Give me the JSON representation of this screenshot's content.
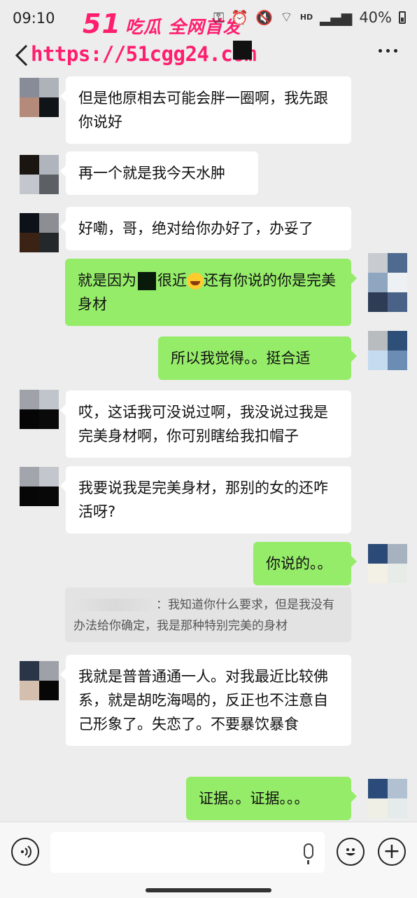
{
  "status": {
    "time": "09:10",
    "battery": "40%",
    "network": "HD"
  },
  "watermark": {
    "logo_number": "51",
    "logo_text": "吃瓜 全网首发",
    "url": "https://51cgg24.com"
  },
  "messages": [
    {
      "side": "left",
      "text": "但是他原相去可能会胖一圈啊，我先跟你说好"
    },
    {
      "side": "left",
      "text": "再一个就是我今天水肿"
    },
    {
      "side": "left",
      "text": "好嘞，哥，绝对给你办好了，办妥了"
    },
    {
      "side": "right",
      "text_a": "就是因为",
      "text_b": "很近",
      "text_c": "还有你说的你是完美身材"
    },
    {
      "side": "right",
      "text": "所以我觉得。。挺合适"
    },
    {
      "side": "left",
      "text": "哎，这话我可没说过啊，我没说过我是完美身材啊，你可别瞎给我扣帽子"
    },
    {
      "side": "left",
      "text": "我要说我是完美身材，那别的女的还咋活呀?"
    },
    {
      "side": "right",
      "text": "你说的。。"
    },
    {
      "side": "left",
      "text": "我就是普普通通一人。对我最近比较佛系，就是胡吃海喝的，反正也不注意自己形象了。失恋了。不要暴饮暴食"
    },
    {
      "side": "right",
      "text": "证据。。证据。。。"
    }
  ],
  "quote": {
    "text": "：我知道你什么要求，但是我没有办法给你确定，我是那种特别完美的身材"
  },
  "icons": {
    "back": "chevron-left-icon",
    "more": "more-dots-icon",
    "voice": "voice-icon",
    "mic": "mic-icon",
    "emoji": "emoji-icon",
    "plus": "plus-icon"
  }
}
